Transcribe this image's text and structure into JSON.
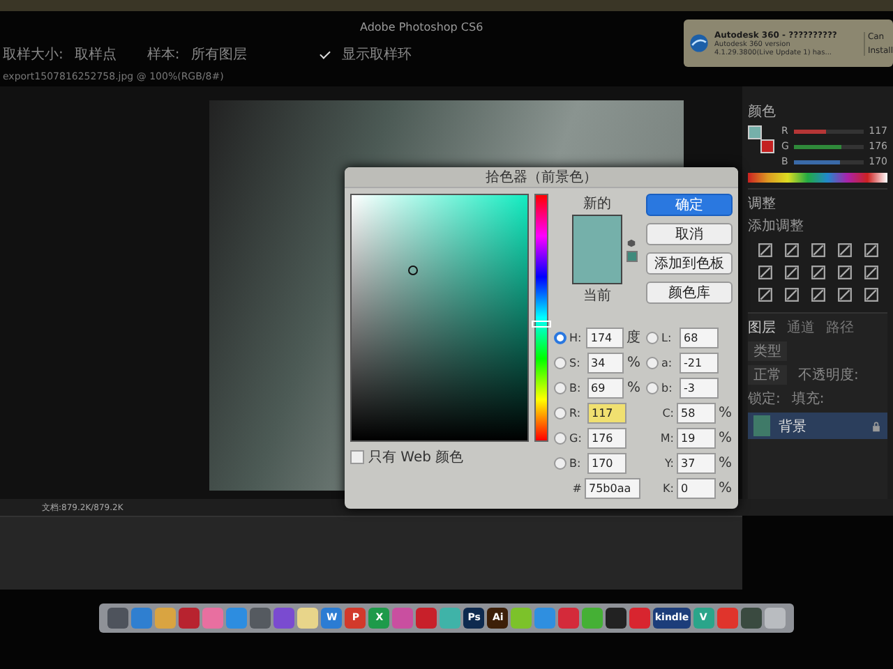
{
  "app": {
    "title": "Adobe Photoshop CS6"
  },
  "options_bar": {
    "sample_size_label": "取样大小:",
    "sample_size": "取样点",
    "sample_label": "样本:",
    "sample": "所有图层",
    "show_ring": {
      "label": "显示取样环",
      "checked": true
    }
  },
  "document_tab": {
    "title": "export1507816252758.jpg @ 100%(RGB/8#)"
  },
  "notification": {
    "title": "Autodesk 360 - ??????????",
    "line_1": "Autodesk 360 version",
    "line_2": "4.1.29.3800(Live Update 1) has...",
    "buttons": [
      "Can",
      "Install"
    ]
  },
  "color_panel": {
    "tab": "颜色",
    "channels": [
      {
        "name": "R",
        "level": 0.46,
        "reading": "117"
      },
      {
        "name": "G",
        "level": 0.69,
        "reading": "176"
      },
      {
        "name": "B",
        "level": 0.67,
        "reading": "170"
      }
    ]
  },
  "adjustments": {
    "tab": "调整",
    "subtitle": "添加调整"
  },
  "layers_panel": {
    "tabs": [
      {
        "label": "图层",
        "selected": true
      },
      {
        "label": "通道",
        "selected": false
      },
      {
        "label": "路径",
        "selected": false
      }
    ],
    "filter": "类型",
    "blend_mode": "正常",
    "opacity_label": "不透明度:",
    "lock_label": "锁定:",
    "fill_label": "填充:",
    "layers": [
      {
        "name": "背景",
        "selected": true,
        "locked": true
      }
    ]
  },
  "status_bar": {
    "doc_size": "文档:879.2K/879.2K"
  },
  "color_picker": {
    "title": "拾色器（前景色）",
    "new_label": "新的",
    "current_label": "当前",
    "hue_slider": {
      "level": 0.52
    },
    "buttons": [
      {
        "label": "确定",
        "primary": true
      },
      {
        "label": "取消",
        "primary": false
      },
      {
        "label": "添加到色板",
        "primary": false
      },
      {
        "label": "颜色库",
        "primary": false
      }
    ],
    "hsb": [
      {
        "name": "H:",
        "value": "174",
        "unit": "度",
        "selected": true
      },
      {
        "name": "S:",
        "value": "34",
        "unit": "%",
        "selected": false
      },
      {
        "name": "B:",
        "value": "69",
        "unit": "%",
        "selected": false
      }
    ],
    "rgb": [
      {
        "name": "R:",
        "value": "117",
        "selected": false,
        "highlighted": true
      },
      {
        "name": "G:",
        "value": "176",
        "selected": false,
        "highlighted": false
      },
      {
        "name": "B:",
        "value": "170",
        "selected": false,
        "highlighted": false
      }
    ],
    "lab": [
      {
        "name": "L:",
        "value": "68",
        "selected": false
      },
      {
        "name": "a:",
        "value": "-21",
        "selected": false
      },
      {
        "name": "b:",
        "value": "-3",
        "selected": false
      }
    ],
    "cmyk": [
      {
        "name": "C:",
        "value": "58",
        "unit": "%"
      },
      {
        "name": "M:",
        "value": "19",
        "unit": "%"
      },
      {
        "name": "Y:",
        "value": "37",
        "unit": "%"
      },
      {
        "name": "K:",
        "value": "0",
        "unit": "%"
      }
    ],
    "hex": {
      "label": "#",
      "value": "75b0aa"
    },
    "web_only": {
      "label": "只有 Web 颜色",
      "checked": false
    }
  },
  "dock": {
    "items": [
      {
        "kind": "icon",
        "color": "#4e535c"
      },
      {
        "kind": "icon",
        "color": "#2f7fd0"
      },
      {
        "kind": "icon",
        "color": "#d9a441"
      },
      {
        "kind": "icon",
        "color": "#b8232f"
      },
      {
        "kind": "icon",
        "color": "#e86fa0"
      },
      {
        "kind": "icon",
        "color": "#2d8de0"
      },
      {
        "kind": "icon",
        "color": "#555a60"
      },
      {
        "kind": "icon",
        "color": "#7a4bd0"
      },
      {
        "kind": "icon",
        "color": "#e8d58a"
      },
      {
        "kind": "letter",
        "label": "W",
        "color": "#2b7cd3"
      },
      {
        "kind": "letter",
        "label": "P",
        "color": "#d2392b"
      },
      {
        "kind": "letter",
        "label": "X",
        "color": "#1e9a4a"
      },
      {
        "kind": "icon",
        "color": "#c94fa0"
      },
      {
        "kind": "icon",
        "color": "#c8202a"
      },
      {
        "kind": "icon",
        "color": "#3fb3a8"
      },
      {
        "kind": "letter",
        "label": "Ps",
        "color": "#0e2a4f"
      },
      {
        "kind": "letter",
        "label": "Ai",
        "color": "#3d1f08"
      },
      {
        "kind": "icon",
        "color": "#7cc22a"
      },
      {
        "kind": "icon",
        "color": "#2f8fe0"
      },
      {
        "kind": "icon",
        "color": "#d42a3a"
      },
      {
        "kind": "icon",
        "color": "#45b035"
      },
      {
        "kind": "icon",
        "color": "#222222"
      },
      {
        "kind": "icon",
        "color": "#d8252f"
      },
      {
        "kind": "letter",
        "label": "kindle",
        "color": "#1c3d7a"
      },
      {
        "kind": "letter",
        "label": "V",
        "color": "#2aa58a"
      },
      {
        "kind": "icon",
        "color": "#e0342c"
      },
      {
        "kind": "icon",
        "color": "#3a4a40"
      },
      {
        "kind": "icon",
        "color": "#b9bcc0"
      }
    ]
  }
}
